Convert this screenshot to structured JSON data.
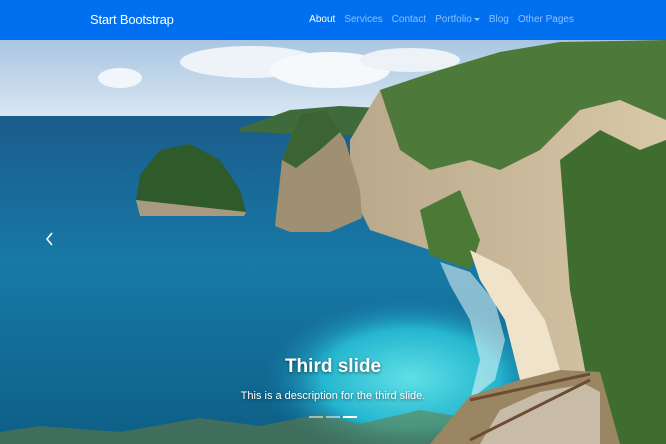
{
  "navbar": {
    "brand": "Start Bootstrap",
    "links": [
      {
        "label": "About",
        "active": true
      },
      {
        "label": "Services",
        "active": false
      },
      {
        "label": "Contact",
        "active": false
      },
      {
        "label": "Portfolio",
        "active": false,
        "dropdown": true
      },
      {
        "label": "Blog",
        "active": false
      },
      {
        "label": "Other Pages",
        "active": false
      }
    ],
    "background_color": "#0070f0"
  },
  "carousel": {
    "active_slide": 3,
    "slide_count": 3,
    "caption": {
      "title": "Third slide",
      "description": "This is a description for the third slide."
    },
    "controls": {
      "prev_icon": "chevron-left-icon",
      "next_icon": "chevron-right-icon"
    }
  }
}
